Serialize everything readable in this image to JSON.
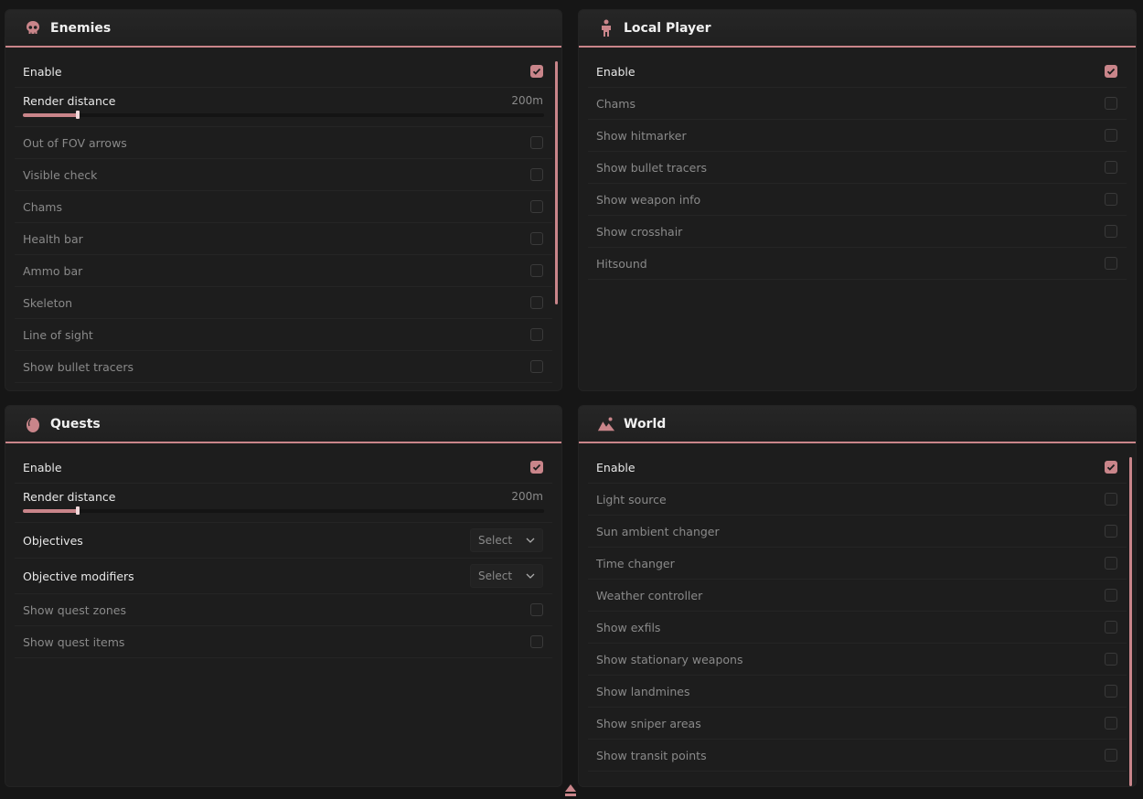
{
  "accent": "#c9858a",
  "panels": {
    "enemies": {
      "title": "Enemies",
      "icon": "skull-icon",
      "enable_label": "Enable",
      "enable_checked": true,
      "render_distance_label": "Render distance",
      "render_distance_value": "200m",
      "render_distance_fraction": 0.105,
      "rows": [
        {
          "label": "Out of FOV arrows",
          "checked": false
        },
        {
          "label": "Visible check",
          "checked": false
        },
        {
          "label": "Chams",
          "checked": false
        },
        {
          "label": "Health bar",
          "checked": false
        },
        {
          "label": "Ammo bar",
          "checked": false
        },
        {
          "label": "Skeleton",
          "checked": false
        },
        {
          "label": "Line of sight",
          "checked": false
        },
        {
          "label": "Show bullet tracers",
          "checked": false
        }
      ]
    },
    "local_player": {
      "title": "Local Player",
      "icon": "person-icon",
      "enable_label": "Enable",
      "enable_checked": true,
      "rows": [
        {
          "label": "Chams",
          "checked": false
        },
        {
          "label": "Show hitmarker",
          "checked": false
        },
        {
          "label": "Show bullet tracers",
          "checked": false
        },
        {
          "label": "Show weapon info",
          "checked": false
        },
        {
          "label": "Show crosshair",
          "checked": false
        },
        {
          "label": "Hitsound",
          "checked": false
        }
      ]
    },
    "quests": {
      "title": "Quests",
      "icon": "egg-icon",
      "enable_label": "Enable",
      "enable_checked": true,
      "render_distance_label": "Render distance",
      "render_distance_value": "200m",
      "render_distance_fraction": 0.105,
      "selects": [
        {
          "label": "Objectives",
          "value": "Select"
        },
        {
          "label": "Objective modifiers",
          "value": "Select"
        }
      ],
      "rows": [
        {
          "label": "Show quest zones",
          "checked": false
        },
        {
          "label": "Show quest items",
          "checked": false
        }
      ]
    },
    "world": {
      "title": "World",
      "icon": "mountain-icon",
      "enable_label": "Enable",
      "enable_checked": true,
      "rows": [
        {
          "label": "Light source",
          "checked": false
        },
        {
          "label": "Sun ambient changer",
          "checked": false
        },
        {
          "label": "Time changer",
          "checked": false
        },
        {
          "label": "Weather controller",
          "checked": false
        },
        {
          "label": "Show exfils",
          "checked": false
        },
        {
          "label": "Show stationary weapons",
          "checked": false
        },
        {
          "label": "Show landmines",
          "checked": false
        },
        {
          "label": "Show sniper areas",
          "checked": false
        },
        {
          "label": "Show transit points",
          "checked": false
        }
      ]
    }
  }
}
